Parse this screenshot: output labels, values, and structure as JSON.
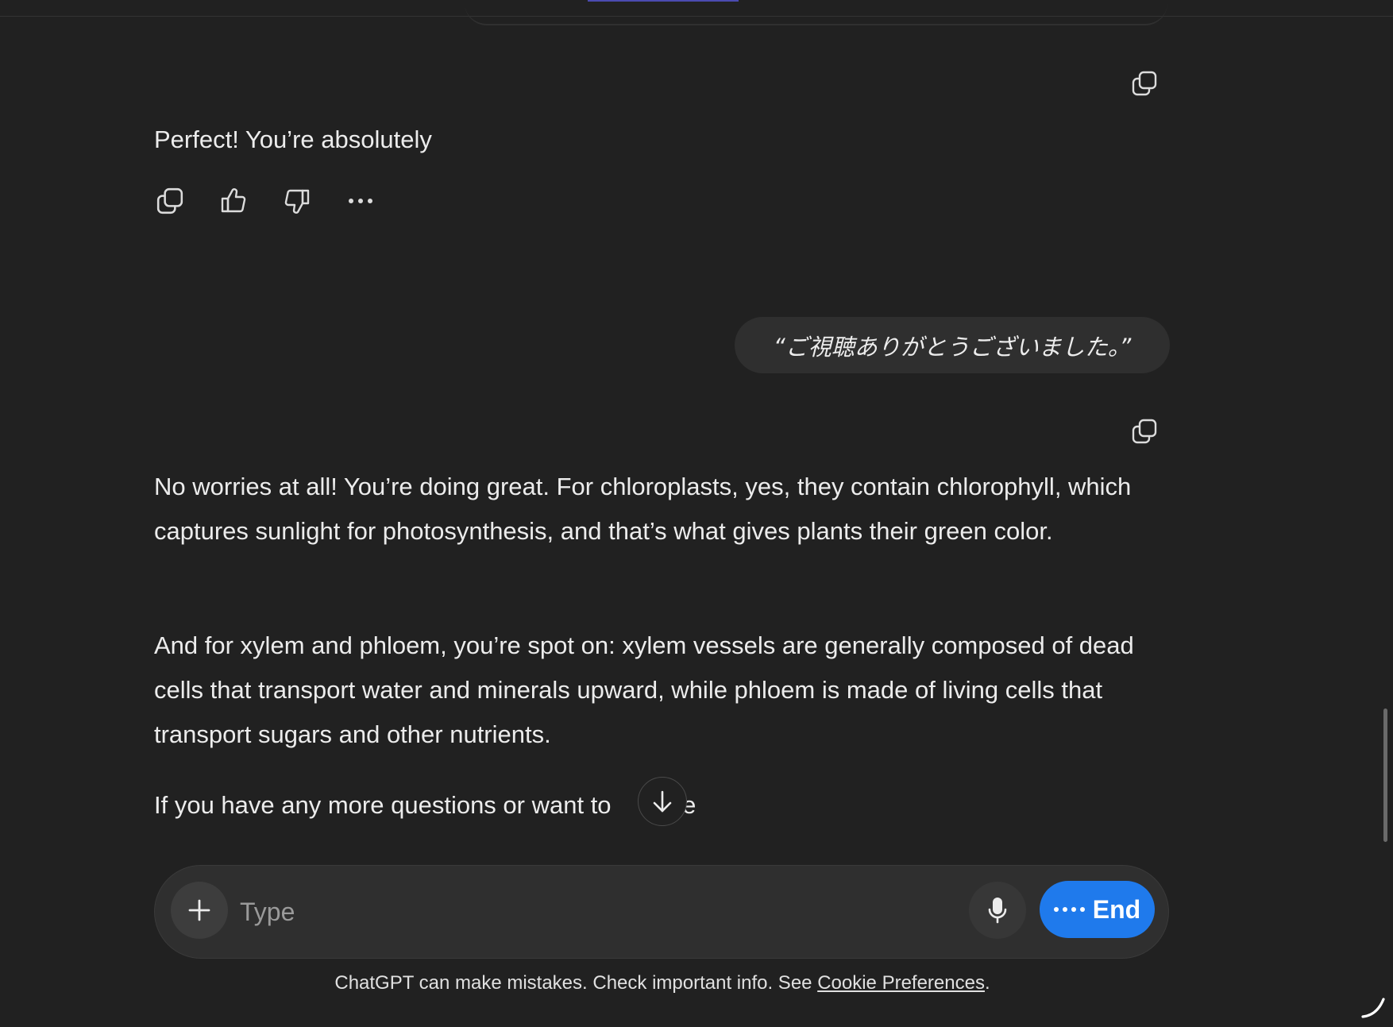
{
  "messages": {
    "assistant_1": {
      "text": "Perfect! You’re absolutely"
    },
    "user_1": {
      "text": "“ご視聴ありがとうございました。”"
    },
    "assistant_2": {
      "paragraphs": [
        "No worries at all! You’re doing great. For chloroplasts, yes, they contain chlorophyll, which captures sunlight for photosynthesis, and that’s what gives plants their green color.",
        "And for xylem and phloem, you’re spot on: xylem vessels are generally composed of dead cells that transport water and minerals upward, while phloem is made of living cells that transport sugars and other nutrients.",
        "If you have any more questions or want to"
      ],
      "partial_tail": "ore"
    }
  },
  "actions": {
    "icons": [
      "copy-icon",
      "thumbs-up-icon",
      "thumbs-down-icon",
      "more-icon"
    ]
  },
  "composer": {
    "placeholder": "Type",
    "end_label": "End"
  },
  "footer": {
    "disclaimer_prefix": "ChatGPT can make mistakes. Check important info. See ",
    "link_label": "Cookie Preferences",
    "disclaimer_suffix": "."
  },
  "colors": {
    "background": "#212121",
    "bubble": "#2f2f2f",
    "accent": "#1f7aec",
    "text": "#ececec"
  }
}
